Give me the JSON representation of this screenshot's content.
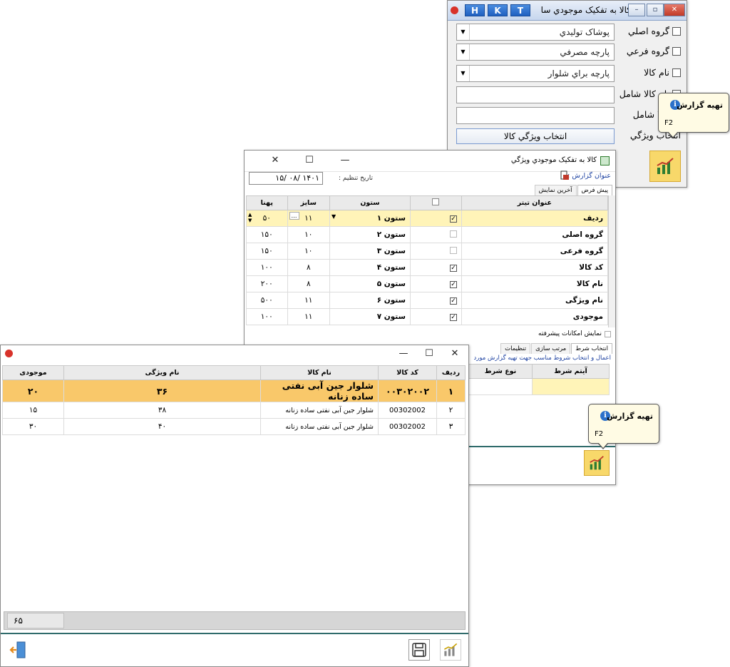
{
  "window1": {
    "title": "کالا به تفکيک موجودي سا",
    "hotkeys": [
      "H",
      "K",
      "T"
    ],
    "rows": [
      {
        "label": "گروه اصلي",
        "value": "پوشاک توليدي"
      },
      {
        "label": "گروه فرعي",
        "value": "پارچه مصرفي"
      },
      {
        "label": "نام کالا",
        "value": "پارچه براي شلوار"
      }
    ],
    "text_rows": [
      {
        "label": "نام کالا شامل",
        "value": ""
      },
      {
        "label": "کالا شامل",
        "value": ""
      }
    ],
    "feature_label": "انتخاب ويژگي",
    "feature_button": "انتخاب ويژگي کالا"
  },
  "tooltip": {
    "title": "تهيه گزارش",
    "key": "F2"
  },
  "window2": {
    "title": "کالا به تفکيک موجودي ويژگي",
    "report_title_label": "عنوان گزارش :",
    "date_label": "تاريخ تنظيم :",
    "date_value": "۱۴۰۱ /۰۸ /۱۵",
    "tabs": [
      "پيش فرض",
      "آخرين نمايش"
    ],
    "columns": [
      "عنوان تيتر",
      "",
      "ستون",
      "سايز",
      "پهنا"
    ],
    "rows": [
      {
        "title": "رديف",
        "checked": true,
        "col": "ستون ۱",
        "size": "۱۱",
        "width": "۵۰"
      },
      {
        "title": "گروه اصلی",
        "checked": false,
        "col": "ستون ۲",
        "size": "۱۰",
        "width": "۱۵۰"
      },
      {
        "title": "گروه فرعی",
        "checked": false,
        "col": "ستون ۳",
        "size": "۱۰",
        "width": "۱۵۰"
      },
      {
        "title": "کد کالا",
        "checked": true,
        "col": "ستون ۴",
        "size": "۸",
        "width": "۱۰۰"
      },
      {
        "title": "نام کالا",
        "checked": true,
        "col": "ستون ۵",
        "size": "۸",
        "width": "۲۰۰"
      },
      {
        "title": "نام ويژگی",
        "checked": true,
        "col": "ستون ۶",
        "size": "۱۱",
        "width": "۵۰۰"
      },
      {
        "title": "موجودی",
        "checked": true,
        "col": "ستون ۷",
        "size": "۱۱",
        "width": "۱۰۰"
      }
    ],
    "advanced_label": "نمايش امکانات پيشرفته",
    "bottom_tabs": [
      "انتخاب شرط",
      "مرتب سازی",
      "تنظيمات"
    ],
    "condition_hint": "اعمال و انتخاب شروط مناسب جهت تهيه گزارش مورد",
    "condition_columns": [
      "آيتم شرط",
      "نوع شرط"
    ]
  },
  "window3": {
    "columns": [
      "رديف",
      "کد کالا",
      "نام کالا",
      "نام ويژگی",
      "موجودی"
    ],
    "rows": [
      {
        "n": "۱",
        "code": "۰۰۳۰۲۰۰۲",
        "name": "شلوار جين آبی نفتی ساده زنانه",
        "feature": "۳۶",
        "stock": "۲۰"
      },
      {
        "n": "۲",
        "code": "00302002",
        "name": "شلوار جين آبی نفتی ساده زنانه",
        "feature": "۳۸",
        "stock": "۱۵"
      },
      {
        "n": "۳",
        "code": "00302002",
        "name": "شلوار جين آبی نفتی ساده زنانه",
        "feature": "۴۰",
        "stock": "۳۰"
      }
    ],
    "total": "۶۵"
  }
}
